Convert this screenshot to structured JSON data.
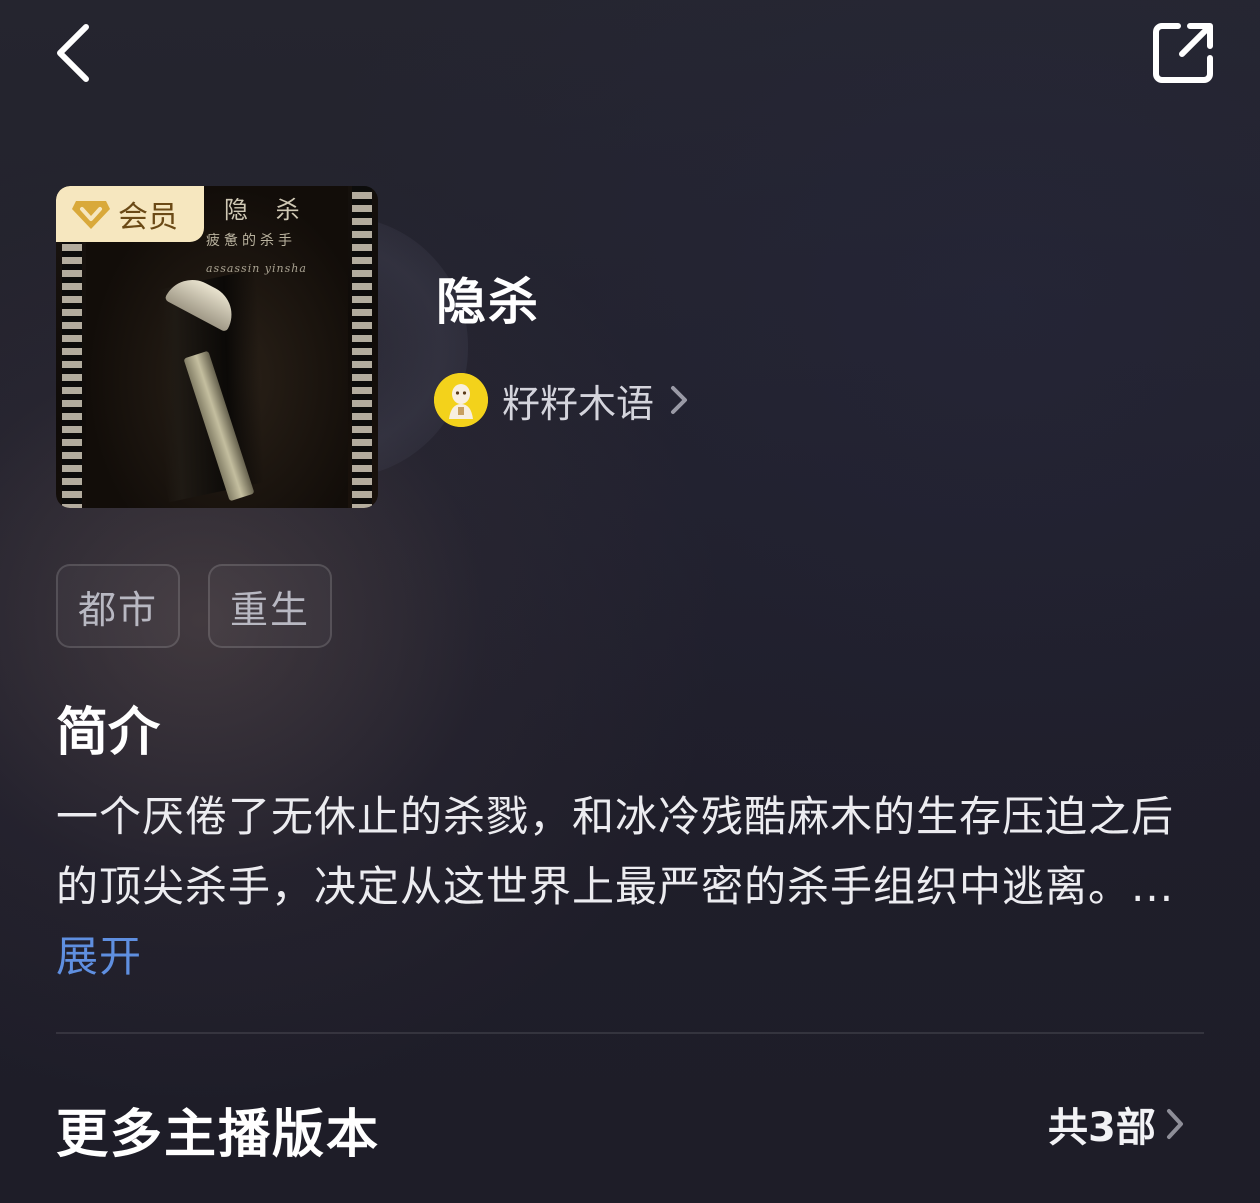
{
  "header": {
    "back_icon": "chevron-left-icon",
    "share_icon": "share-icon"
  },
  "album": {
    "title": "隐杀",
    "cover": {
      "badge_label": "会员",
      "badge_icon": "vip-diamond-icon",
      "title_text": "隐 杀",
      "subtitle_text": "疲惫的杀手",
      "script_text": "assassin yinsha"
    },
    "author": {
      "name": "籽籽木语",
      "avatar_icon": "avatar-icon",
      "arrow_icon": "chevron-right-icon"
    },
    "tags": [
      "都市",
      "重生"
    ]
  },
  "intro": {
    "heading": "简介",
    "text": "一个厌倦了无休止的杀戮，和冰冷残酷麻木的生存压迫之后的顶尖杀手，决定从这世界上最严密的杀手组织中逃离。...",
    "expand_label": "展开"
  },
  "more_versions": {
    "heading": "更多主播版本",
    "count_label": "共3部",
    "arrow_icon": "chevron-right-icon"
  },
  "colors": {
    "accent_link": "#5f8fe0",
    "vip_badge_bg": "#f6e7bf",
    "vip_badge_text": "#6b4a16",
    "avatar_bg": "#f3d21b"
  }
}
